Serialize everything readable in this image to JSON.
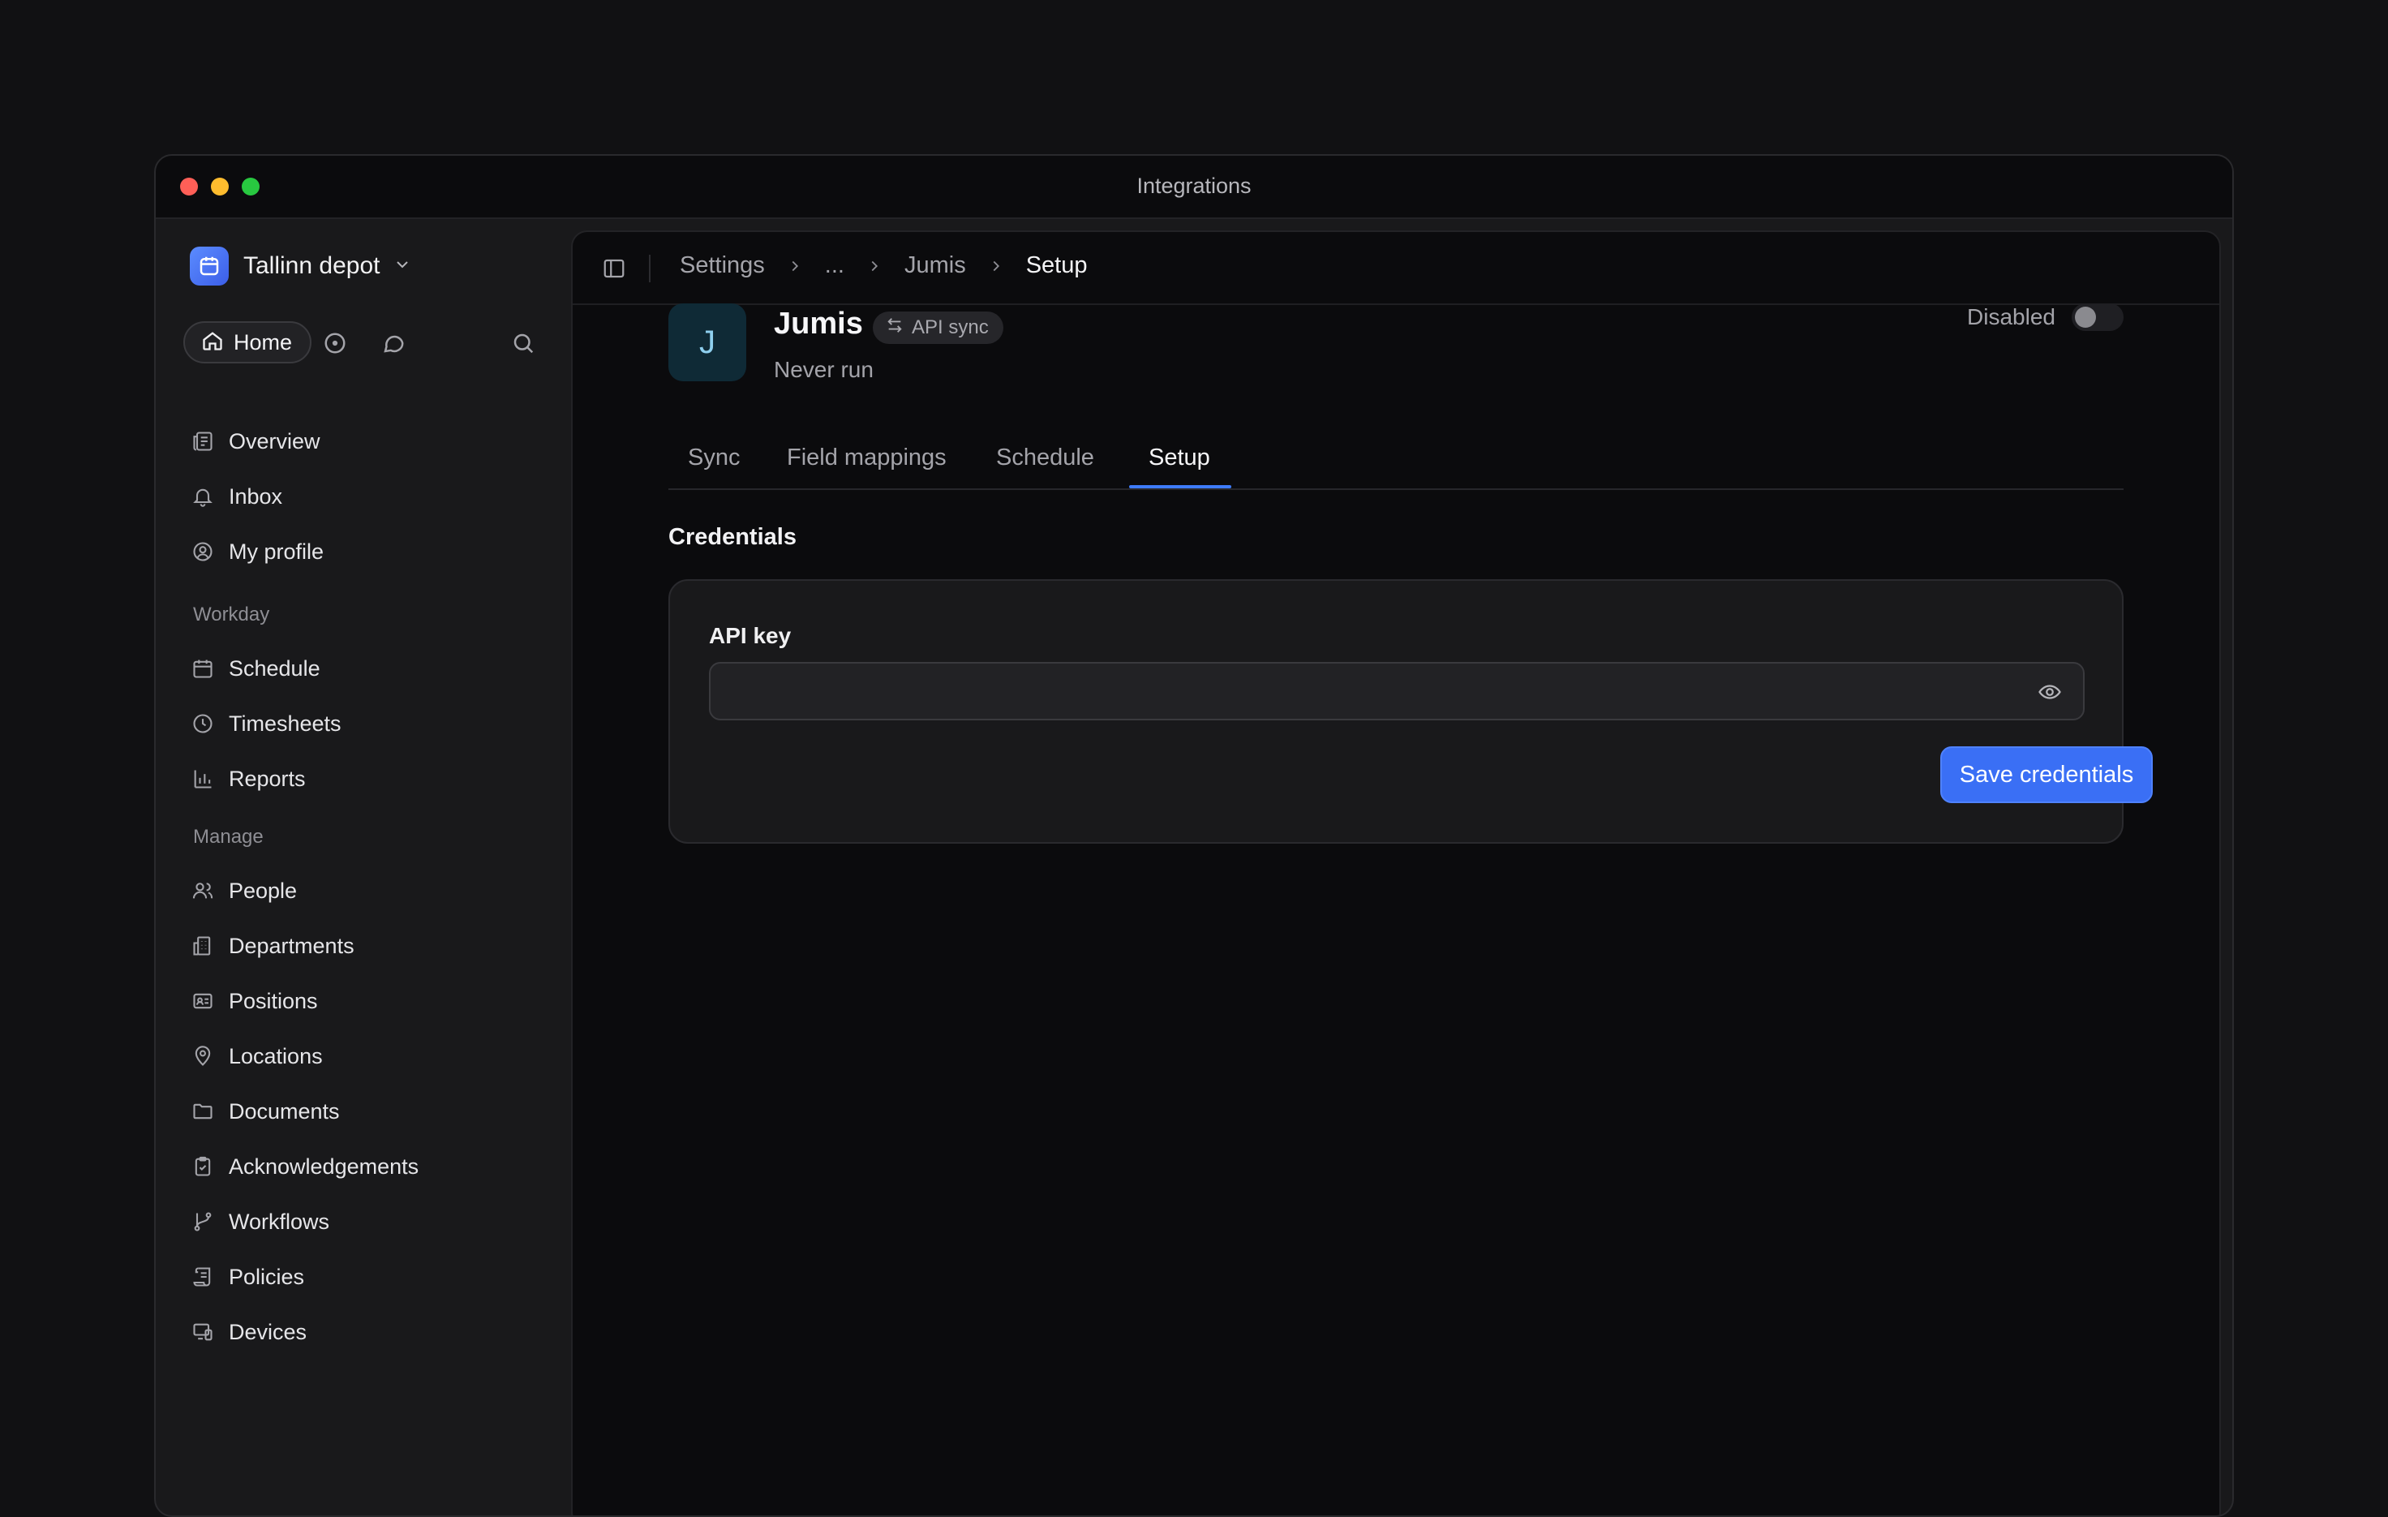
{
  "window": {
    "title": "Integrations"
  },
  "workspace": {
    "name": "Tallinn depot"
  },
  "quickbar": {
    "home_label": "Home"
  },
  "sidebar": {
    "primary": [
      {
        "label": "Overview",
        "icon": "overview-icon"
      },
      {
        "label": "Inbox",
        "icon": "bell-icon"
      },
      {
        "label": "My profile",
        "icon": "user-circle-icon"
      }
    ],
    "workday_label": "Workday",
    "workday": [
      {
        "label": "Schedule",
        "icon": "calendar-icon"
      },
      {
        "label": "Timesheets",
        "icon": "clock-icon"
      },
      {
        "label": "Reports",
        "icon": "bar-chart-icon"
      }
    ],
    "manage_label": "Manage",
    "manage": [
      {
        "label": "People",
        "icon": "people-icon"
      },
      {
        "label": "Departments",
        "icon": "building-icon"
      },
      {
        "label": "Positions",
        "icon": "id-card-icon"
      },
      {
        "label": "Locations",
        "icon": "map-pin-icon"
      },
      {
        "label": "Documents",
        "icon": "folder-icon"
      },
      {
        "label": "Acknowledgements",
        "icon": "clipboard-check-icon"
      },
      {
        "label": "Workflows",
        "icon": "git-branch-icon"
      },
      {
        "label": "Policies",
        "icon": "scroll-icon"
      },
      {
        "label": "Devices",
        "icon": "devices-icon"
      }
    ]
  },
  "breadcrumb": [
    "Settings",
    "...",
    "Jumis",
    "Setup"
  ],
  "integration": {
    "avatar_letter": "J",
    "name": "Jumis",
    "badge": "API sync",
    "status": "Never run",
    "toggle_label": "Disabled",
    "enabled": false
  },
  "tabs": [
    "Sync",
    "Field mappings",
    "Schedule",
    "Setup"
  ],
  "active_tab": "Setup",
  "credentials": {
    "title": "Credentials",
    "api_key_label": "API key",
    "api_key_value": "",
    "save_label": "Save credentials"
  },
  "colors": {
    "accent": "#3a6ff5",
    "background": "#111113",
    "panel": "#0b0b0d",
    "sidebar": "#19191b"
  }
}
